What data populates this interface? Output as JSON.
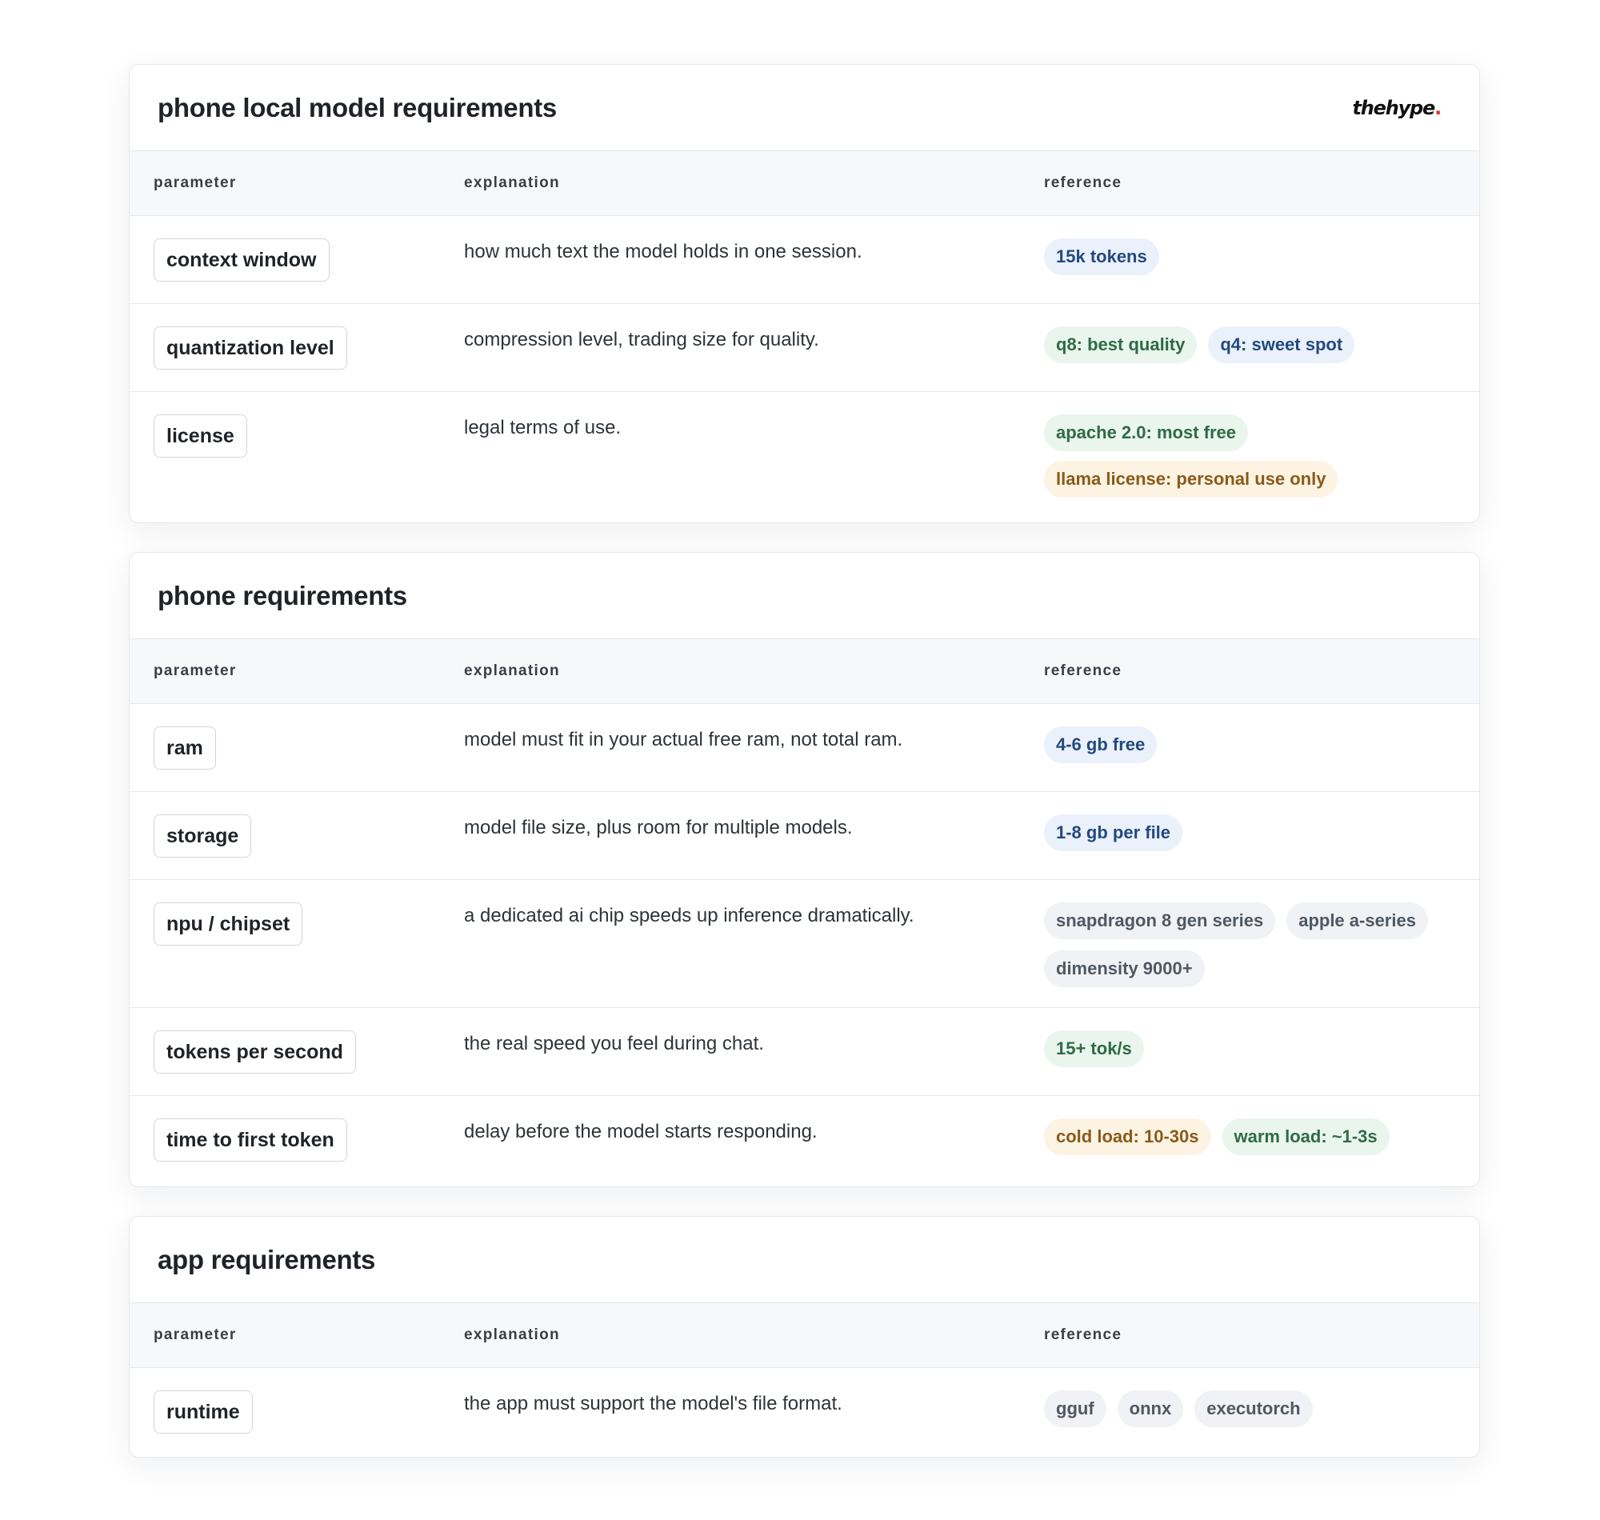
{
  "brand": {
    "logo_text": "thehype",
    "logo_dot": "."
  },
  "columns": {
    "parameter": "parameter",
    "explanation": "explanation",
    "reference": "reference"
  },
  "sections": [
    {
      "title": "phone local model requirements",
      "rows": [
        {
          "param": "context window",
          "explanation": "how much text the model holds in one session.",
          "refs": [
            {
              "text": "15k tokens",
              "color": "blue"
            }
          ]
        },
        {
          "param": "quantization level",
          "explanation": "compression level, trading size for quality.",
          "refs": [
            {
              "text": "q8: best quality",
              "color": "green"
            },
            {
              "text": "q4: sweet spot",
              "color": "blue"
            }
          ]
        },
        {
          "param": "license",
          "explanation": "legal terms of use.",
          "refs": [
            {
              "text": "apache 2.0: most free",
              "color": "green"
            },
            {
              "text": "llama license: personal use only",
              "color": "amber"
            }
          ]
        }
      ]
    },
    {
      "title": "phone requirements",
      "rows": [
        {
          "param": "ram",
          "explanation": "model must fit in your actual free ram, not total ram.",
          "refs": [
            {
              "text": "4-6 gb free",
              "color": "blue"
            }
          ]
        },
        {
          "param": "storage",
          "explanation": "model file size, plus room for multiple models.",
          "refs": [
            {
              "text": "1-8 gb per file",
              "color": "blue"
            }
          ]
        },
        {
          "param": "npu / chipset",
          "explanation": "a dedicated ai chip speeds up inference dramatically.",
          "refs": [
            {
              "text": "snapdragon 8 gen series",
              "color": "gray"
            },
            {
              "text": "apple a-series",
              "color": "gray"
            },
            {
              "text": "dimensity 9000+",
              "color": "gray"
            }
          ]
        },
        {
          "param": "tokens per second",
          "explanation": "the real speed you feel during chat.",
          "refs": [
            {
              "text": "15+ tok/s",
              "color": "green"
            }
          ]
        },
        {
          "param": "time to first token",
          "explanation": "delay before the model starts responding.",
          "refs": [
            {
              "text": "cold load: 10-30s",
              "color": "amber"
            },
            {
              "text": "warm load: ~1-3s",
              "color": "green"
            }
          ]
        }
      ]
    },
    {
      "title": "app requirements",
      "rows": [
        {
          "param": "runtime",
          "explanation": "the app must support the model's file format.",
          "refs": [
            {
              "text": "gguf",
              "color": "gray"
            },
            {
              "text": "onnx",
              "color": "gray"
            },
            {
              "text": "executorch",
              "color": "gray"
            }
          ]
        }
      ]
    }
  ]
}
